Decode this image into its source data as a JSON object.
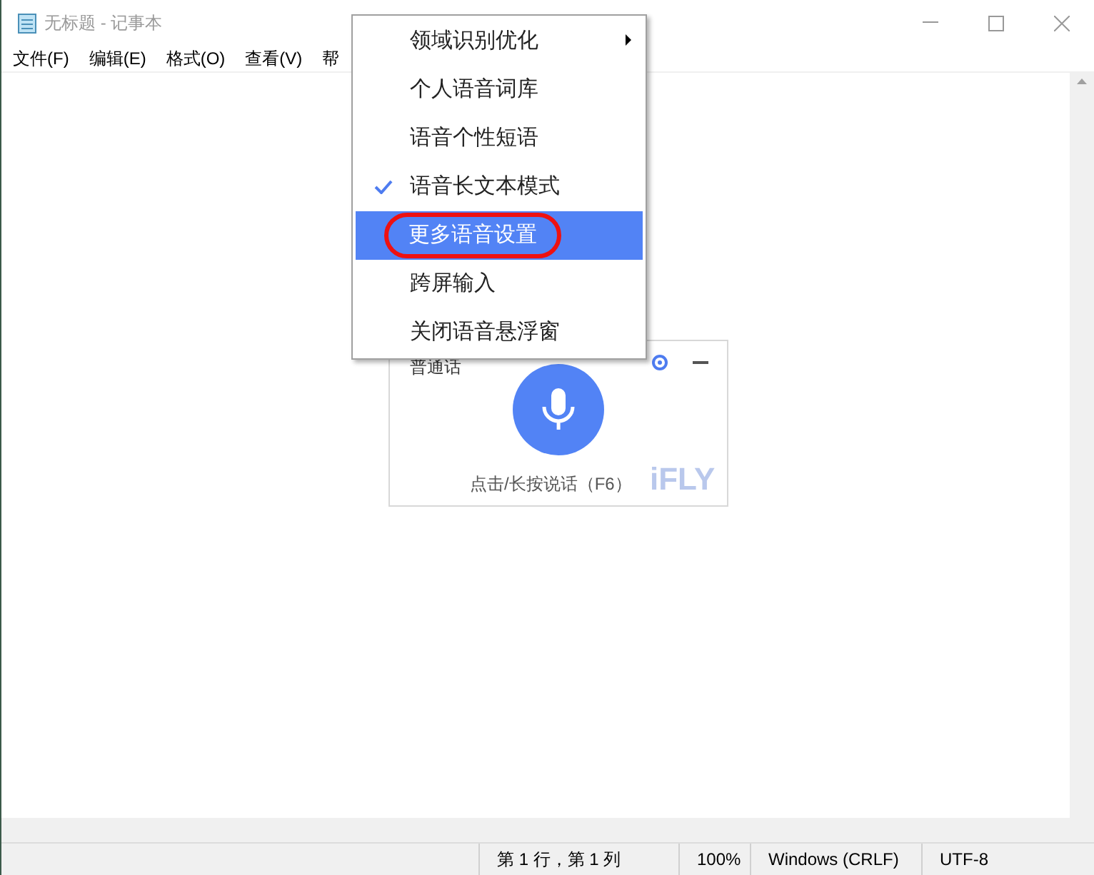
{
  "window": {
    "title": "无标题 - 记事本"
  },
  "menu_bar": [
    {
      "label": "文件(F)"
    },
    {
      "label": "编辑(E)"
    },
    {
      "label": "格式(O)"
    },
    {
      "label": "查看(V)"
    },
    {
      "label": "帮"
    }
  ],
  "context_menu": [
    {
      "label": "领域识别优化",
      "checked": false,
      "selected": false,
      "submenu": true
    },
    {
      "label": "个人语音词库",
      "checked": false,
      "selected": false,
      "submenu": false
    },
    {
      "label": "语音个性短语",
      "checked": false,
      "selected": false,
      "submenu": false
    },
    {
      "label": "语音长文本模式",
      "checked": true,
      "selected": false,
      "submenu": false
    },
    {
      "label": "更多语音设置",
      "checked": false,
      "selected": true,
      "submenu": false,
      "circled": true
    },
    {
      "label": "跨屏输入",
      "checked": false,
      "selected": false,
      "submenu": false
    },
    {
      "label": "关闭语音悬浮窗",
      "checked": false,
      "selected": false,
      "submenu": false
    }
  ],
  "voice_widget": {
    "language": "普通话",
    "hint": "点击/长按说话（F6）",
    "logo": "iFLY"
  },
  "status_bar": [
    "第 1 行，第 1 列",
    "100%",
    "Windows (CRLF)",
    "UTF-8"
  ]
}
